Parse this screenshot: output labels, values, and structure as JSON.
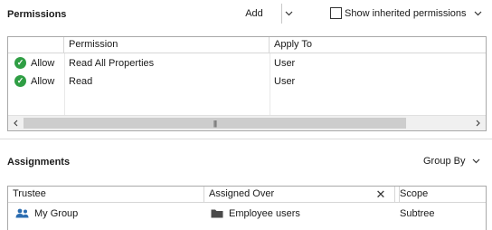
{
  "permissions": {
    "title": "Permissions",
    "add_label": "Add",
    "show_inherited_label": "Show inherited permissions",
    "show_inherited_checked": false,
    "columns": [
      "",
      "Permission",
      "Apply To"
    ],
    "rows": [
      {
        "access": "Allow",
        "permission": "Read All Properties",
        "apply_to": "User"
      },
      {
        "access": "Allow",
        "permission": "Read",
        "apply_to": "User"
      }
    ]
  },
  "assignments": {
    "title": "Assignments",
    "group_by_label": "Group By",
    "columns": [
      "Trustee",
      "Assigned Over",
      "Scope"
    ],
    "rows": [
      {
        "trustee": "My Group",
        "assigned_over": "Employee users",
        "scope": "Subtree"
      }
    ]
  },
  "icons": {
    "allow": "check-circle-icon",
    "group": "group-icon",
    "folder": "folder-icon",
    "close": "close-icon"
  },
  "colors": {
    "allow_green": "#2f9e44",
    "group_blue": "#2b6cb0",
    "folder_dark": "#4a4a4a"
  }
}
